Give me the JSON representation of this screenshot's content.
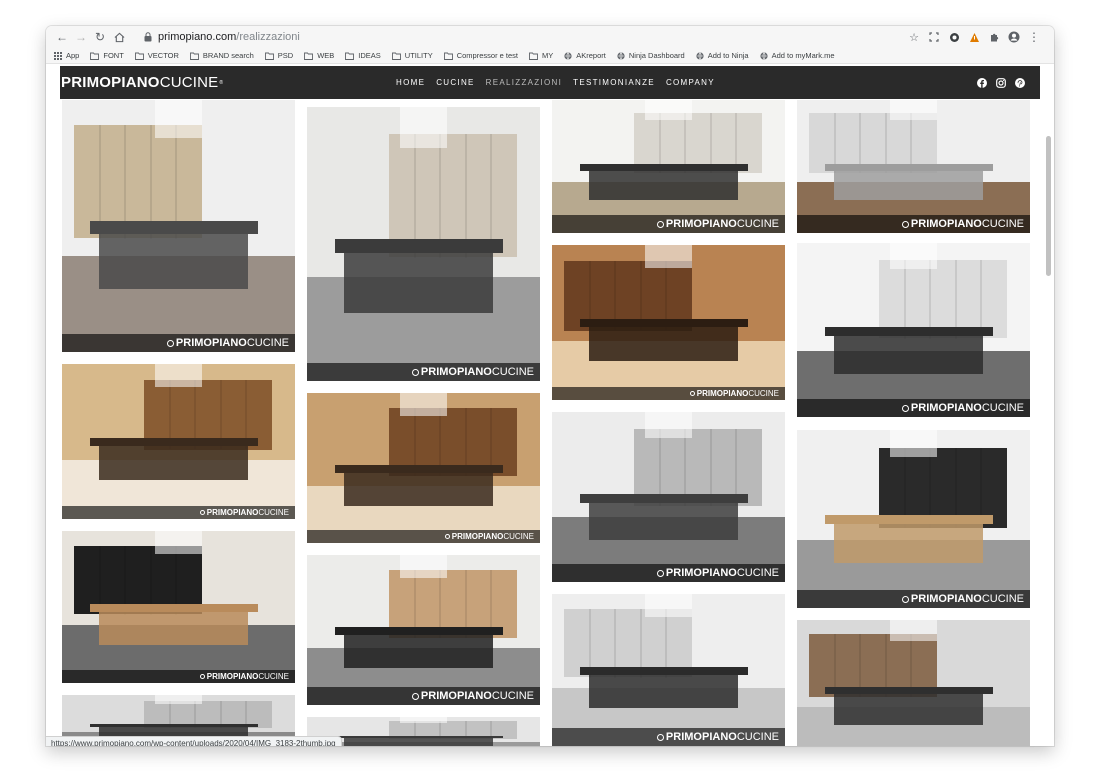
{
  "browser": {
    "url_domain": "primopiano.com",
    "url_path": "/realizzazioni",
    "bookmarks": [
      {
        "label": "App",
        "icon": "apps-grid-icon"
      },
      {
        "label": "FONT",
        "icon": "folder-icon"
      },
      {
        "label": "VECTOR",
        "icon": "folder-icon"
      },
      {
        "label": "BRAND search",
        "icon": "folder-icon"
      },
      {
        "label": "PSD",
        "icon": "folder-icon"
      },
      {
        "label": "WEB",
        "icon": "folder-icon"
      },
      {
        "label": "IDEAS",
        "icon": "folder-icon"
      },
      {
        "label": "UTILITY",
        "icon": "folder-icon"
      },
      {
        "label": "Compressor e test",
        "icon": "folder-icon"
      },
      {
        "label": "MY",
        "icon": "folder-icon"
      },
      {
        "label": "AKreport",
        "icon": "globe-icon"
      },
      {
        "label": "Ninja Dashboard",
        "icon": "globe-icon"
      },
      {
        "label": "Add to Ninja",
        "icon": "globe-icon"
      },
      {
        "label": "Add to myMark.me",
        "icon": "globe-icon"
      }
    ],
    "status_url": "https://www.primopiano.com/wp-content/uploads/2020/04/IMG_3183-2thumb.jpg"
  },
  "site": {
    "logo_bold": "PRIMOPIANO",
    "logo_light": "CUCINE",
    "logo_mark": "®",
    "nav": [
      "HOME",
      "CUCINE",
      "REALIZZAZIONI",
      "TESTIMONIANZE",
      "COMPANY"
    ],
    "nav_active_index": 2,
    "social": [
      "facebook-icon",
      "instagram-icon",
      "pinterest-icon"
    ]
  },
  "gallery": {
    "watermark_bold": "PRIMOPIANO",
    "watermark_light": "CUCINE",
    "tiles": [
      {
        "name": "gallery-photo-1",
        "wm": "large"
      },
      {
        "name": "gallery-photo-2",
        "wm": "large"
      },
      {
        "name": "gallery-photo-3",
        "wm": "large"
      },
      {
        "name": "gallery-photo-4",
        "wm": "large"
      },
      {
        "name": "gallery-photo-5",
        "wm": "small"
      },
      {
        "name": "gallery-photo-6",
        "wm": "small"
      },
      {
        "name": "gallery-photo-7",
        "wm": "small"
      },
      {
        "name": "gallery-photo-8",
        "wm": "large"
      },
      {
        "name": "gallery-photo-9",
        "wm": "large"
      },
      {
        "name": "gallery-photo-10",
        "wm": "small"
      },
      {
        "name": "gallery-photo-11",
        "wm": "large"
      },
      {
        "name": "gallery-photo-12",
        "wm": "large"
      },
      {
        "name": "gallery-photo-13",
        "wm": "large"
      },
      {
        "name": "gallery-photo-14",
        "wm": "none"
      },
      {
        "name": "gallery-photo-15",
        "wm": "none"
      },
      {
        "name": "gallery-photo-16",
        "wm": "none"
      },
      {
        "name": "gallery-photo-17",
        "wm": "none"
      }
    ]
  }
}
